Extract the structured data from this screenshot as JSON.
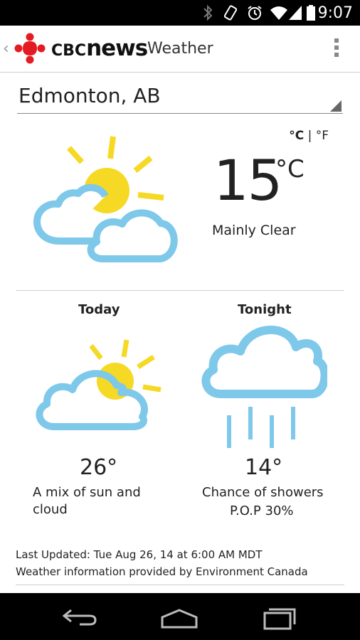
{
  "status_bar": {
    "time": "9:07",
    "icons": [
      "bluetooth-icon",
      "vibrate-icon",
      "alarm-icon",
      "wifi-icon",
      "signal-icon",
      "battery-icon"
    ]
  },
  "app_bar": {
    "brand_prefix": "CBC",
    "brand_main": "news",
    "title": "Weather",
    "icons": [
      "back-chevron-icon",
      "cbc-gem-logo",
      "overflow-menu-icon"
    ]
  },
  "location": {
    "city": "Edmonton, AB"
  },
  "units": {
    "celsius": "°C",
    "separator": "|",
    "fahrenheit": "°F"
  },
  "current": {
    "temp": "15",
    "unit": "°C",
    "condition": "Mainly Clear",
    "icon": "sun-behind-clouds-icon"
  },
  "forecast": {
    "today": {
      "label": "Today",
      "temp": "26°",
      "desc_line1": "A mix of sun and",
      "desc_line2": "cloud",
      "icon": "sun-cloud-icon"
    },
    "tonight": {
      "label": "Tonight",
      "temp": "14°",
      "desc": "Chance of showers",
      "pop": "P.O.P 30%",
      "icon": "rain-cloud-icon"
    }
  },
  "footer": {
    "updated": "Last Updated: Tue Aug 26, 14 at 6:00 AM MDT",
    "provider": "Weather information provided by Environment Canada"
  },
  "colors": {
    "sun": "#f6d925",
    "cloud": "#7ec8ea",
    "cbc_red": "#e51b23"
  },
  "nav_bar": {
    "icons": [
      "back-icon",
      "home-icon",
      "recent-apps-icon"
    ]
  }
}
